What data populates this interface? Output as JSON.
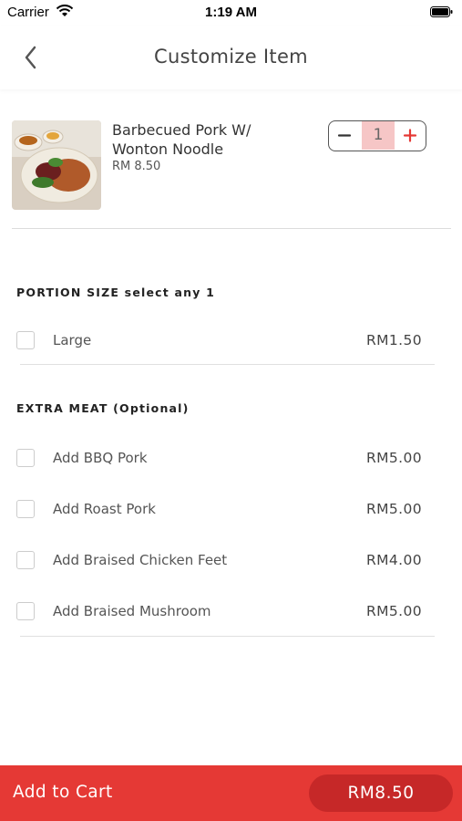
{
  "status_bar": {
    "carrier": "Carrier",
    "time": "1:19 AM"
  },
  "nav": {
    "title": "Customize Item"
  },
  "item": {
    "name": "Barbecued Pork W/ Wonton Noodle",
    "price": "RM 8.50",
    "quantity": "1",
    "stepper_minus": "−",
    "stepper_plus": "+"
  },
  "portion": {
    "title": "PORTION SIZE select any 1",
    "options": [
      {
        "label": "Large",
        "price": "RM1.50"
      }
    ]
  },
  "extra_meat": {
    "title": "EXTRA MEAT (Optional)",
    "options": [
      {
        "label": "Add BBQ Pork",
        "price": "RM5.00"
      },
      {
        "label": "Add Roast Pork",
        "price": "RM5.00"
      },
      {
        "label": "Add Braised Chicken Feet",
        "price": "RM4.00"
      },
      {
        "label": "Add Braised Mushroom",
        "price": "RM5.00"
      }
    ]
  },
  "cart": {
    "label": "Add to Cart",
    "total": "RM8.50"
  },
  "colors": {
    "accent": "#e53935",
    "accent_dark": "#c62828",
    "qty_bg": "#f6c6c6"
  },
  "icons": [
    "wifi-icon",
    "battery-icon",
    "back-chevron-icon",
    "minus-icon",
    "plus-icon",
    "checkbox-icon"
  ]
}
